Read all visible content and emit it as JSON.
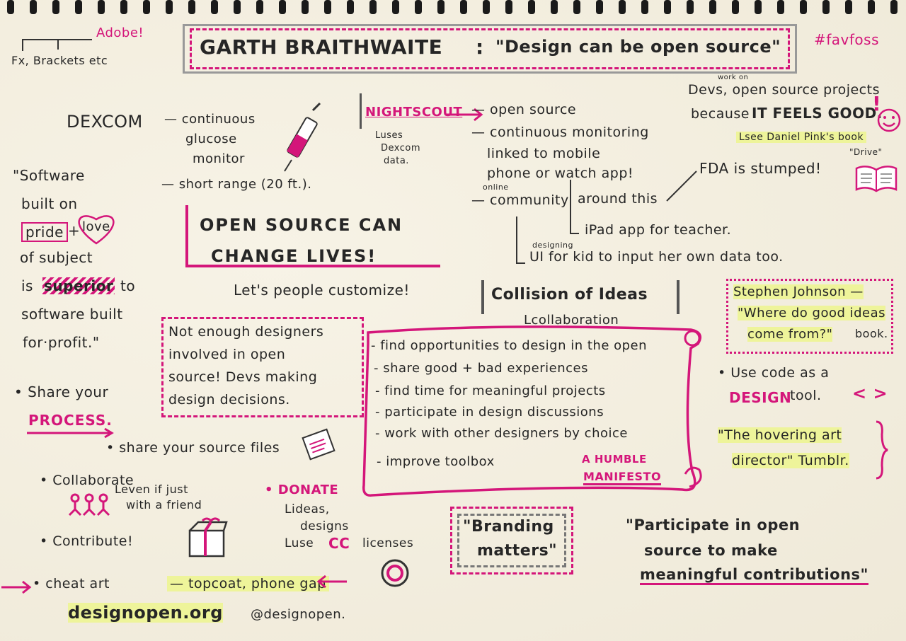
{
  "title": {
    "speaker": "GARTH BRAITHWAITE",
    "sep": ":",
    "quote": "\"Design can be open source\""
  },
  "hashtag": "#favfoss",
  "adobe": {
    "brand": "Adobe!",
    "products": "Fx, Brackets etc"
  },
  "dexcom": {
    "name": "DEXCOM",
    "desc1": "— continuous",
    "desc2": "glucose",
    "desc3": "monitor",
    "range": "— short range (20 ft.)."
  },
  "nightscout": {
    "name": "NIGHTSCOUT",
    "uses1": "Luses",
    "uses2": "Dexcom",
    "uses3": "data.",
    "p1": "— open source",
    "p2": "— continuous monitoring",
    "p3": "linked to mobile",
    "p4": "phone or watch app!",
    "online": "online",
    "p5": "— community",
    "p6": "around this",
    "p7": "iPad app for teacher.",
    "designing": "designing",
    "p8": "UI for kid to input her own data too."
  },
  "devs": {
    "workon": "work on",
    "l1": "Devs, open source projects",
    "l2": "because",
    "feels": "IT FEELS GOOD.",
    "excl": "!",
    "pink": "Lsee Daniel Pink's book",
    "drive": "\"Drive\"",
    "fda": "FDA is stumped!"
  },
  "software": {
    "l1": "\"Software",
    "l2": "built on",
    "pride": "pride",
    "plus": "+",
    "love": "love",
    "l3": "of subject",
    "l4": "is",
    "superior": "superior",
    "to": "to",
    "l5": "software built",
    "l6": "for·profit.\""
  },
  "change": {
    "l1": "OPEN SOURCE CAN",
    "l2": "CHANGE LIVES!",
    "customize": "Let's people customize!"
  },
  "notenough": {
    "l1": "Not enough designers",
    "l2": "involved in open",
    "l3": "source! Devs making",
    "l4": "design decisions."
  },
  "collision": {
    "title": "Collision of Ideas",
    "sub": "Lcollaboration"
  },
  "johnson": {
    "l1": "Stephen Johnson —",
    "l2": "\"Where do good ideas",
    "l3": "come from?\"",
    "l4": "book."
  },
  "manifesto": {
    "items": [
      "- find opportunities to design in the open",
      "- share good + bad experiences",
      "- find time for meaningful projects",
      "- participate in design discussions",
      "- work with other designers by choice",
      "- improve toolbox"
    ],
    "label1": "A HUMBLE",
    "label2": "MANIFESTO"
  },
  "code": {
    "l1": "• Use code as a",
    "design": "DESIGN",
    "tool": "tool.",
    "brackets": "< >"
  },
  "hovering": {
    "l1": "\"The hovering art",
    "l2": "director\" Tumblr."
  },
  "process": {
    "share": "• Share your",
    "process": "PROCESS.",
    "files": "• share your source files",
    "collab": "• Collaborate",
    "friend1": "Leven if just",
    "friend2": "with a friend",
    "contribute": "• Contribute!",
    "donate": "• DONATE",
    "ideas": "Lideas,",
    "designs": "designs",
    "use": "Luse",
    "cc": "CC",
    "licenses": "licenses"
  },
  "branding": {
    "l1": "\"Branding",
    "l2": "matters\""
  },
  "participate": {
    "l1": "\"Participate in open",
    "l2": "source to make",
    "l3": "meaningful contributions\""
  },
  "cheat": {
    "l1": "• cheat art",
    "l2": "— topcoat, phone gap",
    "site": "designopen.org",
    "twitter": "@designopen."
  },
  "colors": {
    "accent": "#d4167a",
    "ink": "#222222",
    "highlight": "#eef49a",
    "paper": "#f3efe2"
  }
}
